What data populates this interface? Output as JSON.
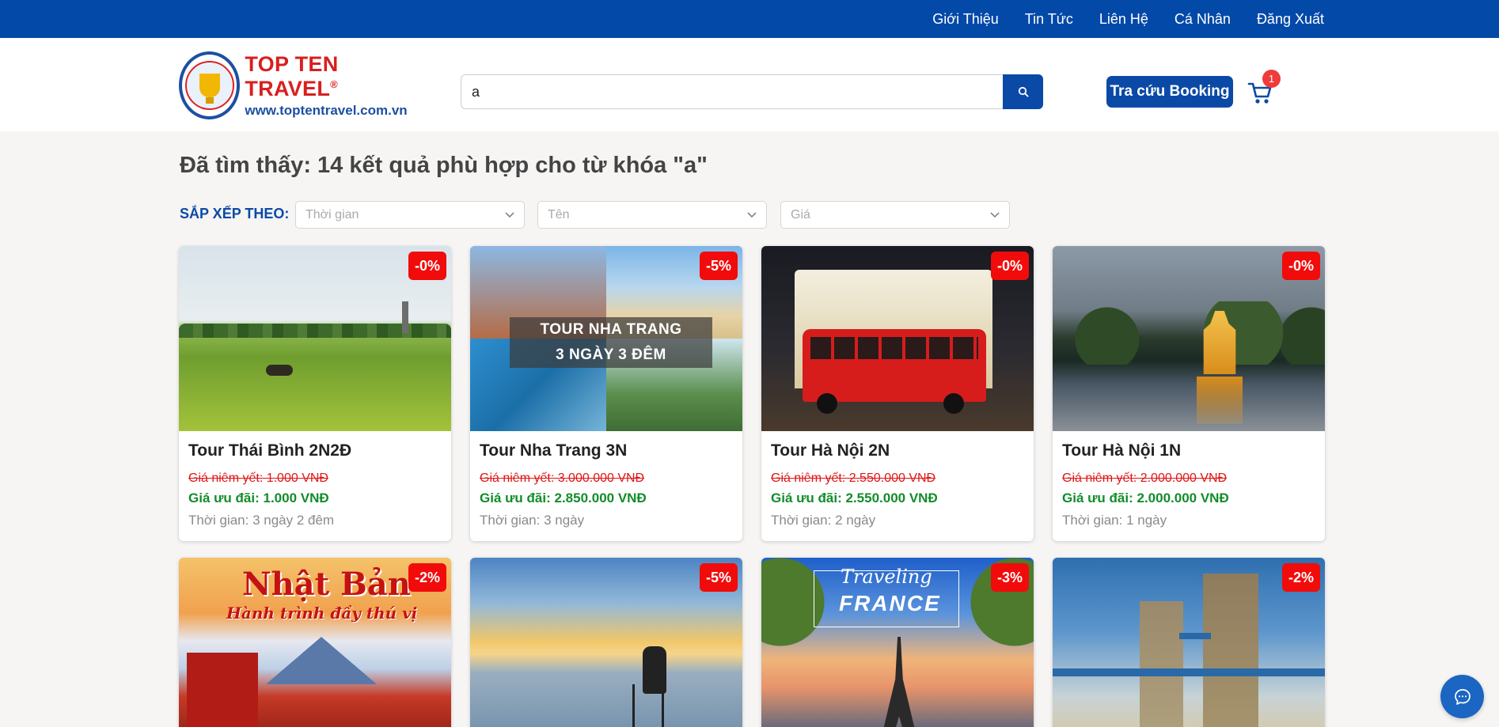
{
  "nav": {
    "items": [
      "Giới Thiệu",
      "Tin Tức",
      "Liên Hệ",
      "Cá Nhân",
      "Đăng Xuất"
    ]
  },
  "logo": {
    "title": "TOP TEN TRAVEL",
    "reg": "®",
    "url": "www.toptentravel.com.vn"
  },
  "search": {
    "value": "a",
    "icon": "search-icon"
  },
  "header": {
    "booking_label": "Tra cứu Booking",
    "cart_count": "1"
  },
  "results": {
    "title": "Đã tìm thấy: 14 kết quả phù hợp cho từ khóa \"a\""
  },
  "sort": {
    "label": "SẮP XẾP THEO:",
    "time_placeholder": "Thời gian",
    "name_placeholder": "Tên",
    "price_placeholder": "Giá"
  },
  "tours": [
    {
      "name": "Tour Thái Bình 2N2Đ",
      "discount": "-0%",
      "old_price": "Giá niêm yết: 1.000 VNĐ",
      "new_price": "Giá ưu đãi: 1.000 VNĐ",
      "duration": "Thời gian: 3 ngày 2 đêm"
    },
    {
      "name": "Tour Nha Trang 3N",
      "discount": "-5%",
      "old_price": "Giá niêm yết: 3.000.000 VNĐ",
      "new_price": "Giá ưu đãi: 2.850.000 VNĐ",
      "duration": "Thời gian: 3 ngày",
      "image_text": [
        "TOUR NHA TRANG",
        "3 NGÀY 3 ĐÊM"
      ]
    },
    {
      "name": "Tour Hà Nội 2N",
      "discount": "-0%",
      "old_price": "Giá niêm yết: 2.550.000 VNĐ",
      "new_price": "Giá ưu đãi: 2.550.000 VNĐ",
      "duration": "Thời gian: 2 ngày"
    },
    {
      "name": "Tour Hà Nội 1N",
      "discount": "-0%",
      "old_price": "Giá niêm yết: 2.000.000 VNĐ",
      "new_price": "Giá ưu đãi: 2.000.000 VNĐ",
      "duration": "Thời gian: 1 ngày"
    },
    {
      "discount": "-2%",
      "image_text": [
        "Nhật Bản",
        "Hành trình đầy thú vị"
      ]
    },
    {
      "discount": "-5%"
    },
    {
      "discount": "-3%",
      "image_text": [
        "Traveling",
        "FRANCE"
      ]
    },
    {
      "discount": "-2%"
    }
  ],
  "colors": {
    "brand_blue": "#0349a8",
    "discount_red": "#f20b0b",
    "price_green": "#128c2a"
  }
}
